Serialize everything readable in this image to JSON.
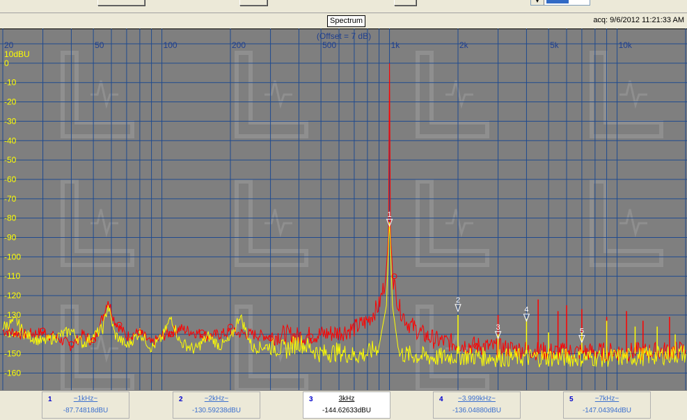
{
  "window": {
    "plot_title": "Spectrum",
    "acquired": "acq: 9/6/2012 11:21:33 AM"
  },
  "chart_data": {
    "type": "line",
    "title": "Spectrum",
    "offset_label": "(Offset = 7 dB)",
    "unit_label": "10dBU",
    "x_scale": "log",
    "xlim": [
      20,
      20000
    ],
    "ylim": [
      -167,
      10
    ],
    "grid": true,
    "x_tick_labels": [
      {
        "value": 20,
        "label": "20"
      },
      {
        "value": 50,
        "label": "50"
      },
      {
        "value": 100,
        "label": "100"
      },
      {
        "value": 200,
        "label": "200"
      },
      {
        "value": 500,
        "label": "500"
      },
      {
        "value": 1000,
        "label": "1k"
      },
      {
        "value": 2000,
        "label": "2k"
      },
      {
        "value": 5000,
        "label": "5k"
      },
      {
        "value": 10000,
        "label": "10k"
      }
    ],
    "y_tick_labels": [
      "0",
      "-10",
      "-20",
      "-30",
      "-40",
      "-50",
      "-60",
      "-70",
      "-80",
      "-90",
      "-100",
      "-110",
      "-120",
      "-130",
      "-140",
      "-150",
      "-160"
    ],
    "series": [
      {
        "color": "#ff0000",
        "points": [
          [
            20,
            -138
          ],
          [
            25,
            -140
          ],
          [
            30,
            -139
          ],
          [
            35,
            -142
          ],
          [
            40,
            -146
          ],
          [
            45,
            -140
          ],
          [
            50,
            -144
          ],
          [
            55,
            -131
          ],
          [
            58,
            -122
          ],
          [
            62,
            -133
          ],
          [
            70,
            -141
          ],
          [
            80,
            -139
          ],
          [
            90,
            -145
          ],
          [
            100,
            -141
          ],
          [
            120,
            -137
          ],
          [
            140,
            -139
          ],
          [
            160,
            -141
          ],
          [
            180,
            -140
          ],
          [
            200,
            -139
          ],
          [
            250,
            -140
          ],
          [
            300,
            -141
          ],
          [
            350,
            -140
          ],
          [
            400,
            -141
          ],
          [
            500,
            -140
          ],
          [
            600,
            -139
          ],
          [
            700,
            -137
          ],
          [
            800,
            -133
          ],
          [
            900,
            -125
          ],
          [
            960,
            -112
          ],
          [
            990,
            -90
          ],
          [
            1000,
            0
          ],
          [
            1010,
            -90
          ],
          [
            1040,
            -112
          ],
          [
            1100,
            -126
          ],
          [
            1200,
            -134
          ],
          [
            1400,
            -140
          ],
          [
            1600,
            -143
          ],
          [
            2000,
            -145
          ],
          [
            2500,
            -146
          ],
          [
            3000,
            -147
          ],
          [
            4000,
            -148
          ],
          [
            5000,
            -149
          ],
          [
            7000,
            -149
          ],
          [
            10000,
            -149
          ],
          [
            14000,
            -149
          ],
          [
            20000,
            -148
          ]
        ],
        "spurs": [
          [
            3000,
            -130
          ],
          [
            4500,
            -122
          ],
          [
            5500,
            -128
          ],
          [
            6000,
            -125
          ],
          [
            7000,
            -127
          ],
          [
            9000,
            -131
          ],
          [
            11000,
            -128
          ],
          [
            13000,
            -133
          ],
          [
            17000,
            -131
          ]
        ]
      },
      {
        "color": "#ffff00",
        "points": [
          [
            20,
            -136
          ],
          [
            23,
            -133
          ],
          [
            25,
            -140
          ],
          [
            30,
            -144
          ],
          [
            35,
            -141
          ],
          [
            40,
            -138
          ],
          [
            45,
            -145
          ],
          [
            50,
            -141
          ],
          [
            55,
            -137
          ],
          [
            58,
            -125
          ],
          [
            62,
            -140
          ],
          [
            70,
            -146
          ],
          [
            80,
            -139
          ],
          [
            90,
            -147
          ],
          [
            100,
            -142
          ],
          [
            110,
            -131
          ],
          [
            120,
            -144
          ],
          [
            140,
            -148
          ],
          [
            160,
            -141
          ],
          [
            180,
            -146
          ],
          [
            200,
            -143
          ],
          [
            220,
            -130
          ],
          [
            250,
            -147
          ],
          [
            300,
            -146
          ],
          [
            350,
            -148
          ],
          [
            400,
            -144
          ],
          [
            500,
            -150
          ],
          [
            600,
            -149
          ],
          [
            700,
            -151
          ],
          [
            800,
            -150
          ],
          [
            900,
            -146
          ],
          [
            970,
            -125
          ],
          [
            990,
            -95
          ],
          [
            1000,
            -82
          ],
          [
            1010,
            -95
          ],
          [
            1030,
            -125
          ],
          [
            1100,
            -150
          ],
          [
            1300,
            -151
          ],
          [
            1600,
            -152
          ],
          [
            2000,
            -151
          ],
          [
            3000,
            -152
          ],
          [
            5000,
            -152
          ],
          [
            7000,
            -152
          ],
          [
            10000,
            -152
          ],
          [
            15000,
            -151
          ],
          [
            20000,
            -150
          ]
        ],
        "spurs": [
          [
            2000,
            -130
          ],
          [
            3000,
            -140
          ],
          [
            4000,
            -132
          ],
          [
            5000,
            -139
          ],
          [
            7000,
            -139
          ],
          [
            9000,
            -133
          ],
          [
            12000,
            -136
          ],
          [
            15000,
            -136
          ],
          [
            18000,
            -140
          ]
        ]
      }
    ],
    "plot_markers": [
      {
        "id": "1",
        "freq": 1000,
        "level": -82
      },
      {
        "id": "2",
        "freq": 2000,
        "level": -126
      },
      {
        "id": "3",
        "freq": 3000,
        "level": -140
      },
      {
        "id": "4",
        "freq": 3999,
        "level": -131
      },
      {
        "id": "5",
        "freq": 7000,
        "level": -142
      }
    ]
  },
  "markers": [
    {
      "num": "1",
      "freq": "~1kHz~",
      "level": "-87.74818dBU"
    },
    {
      "num": "2",
      "freq": "~2kHz~",
      "level": "-130.59238dBU"
    },
    {
      "num": "3",
      "freq": "3kHz",
      "level": "-144.62633dBU"
    },
    {
      "num": "4",
      "freq": "~3.999kHz~",
      "level": "-136.04880dBU"
    },
    {
      "num": "5",
      "freq": "~7kHz~",
      "level": "-147.04394dBU"
    }
  ]
}
